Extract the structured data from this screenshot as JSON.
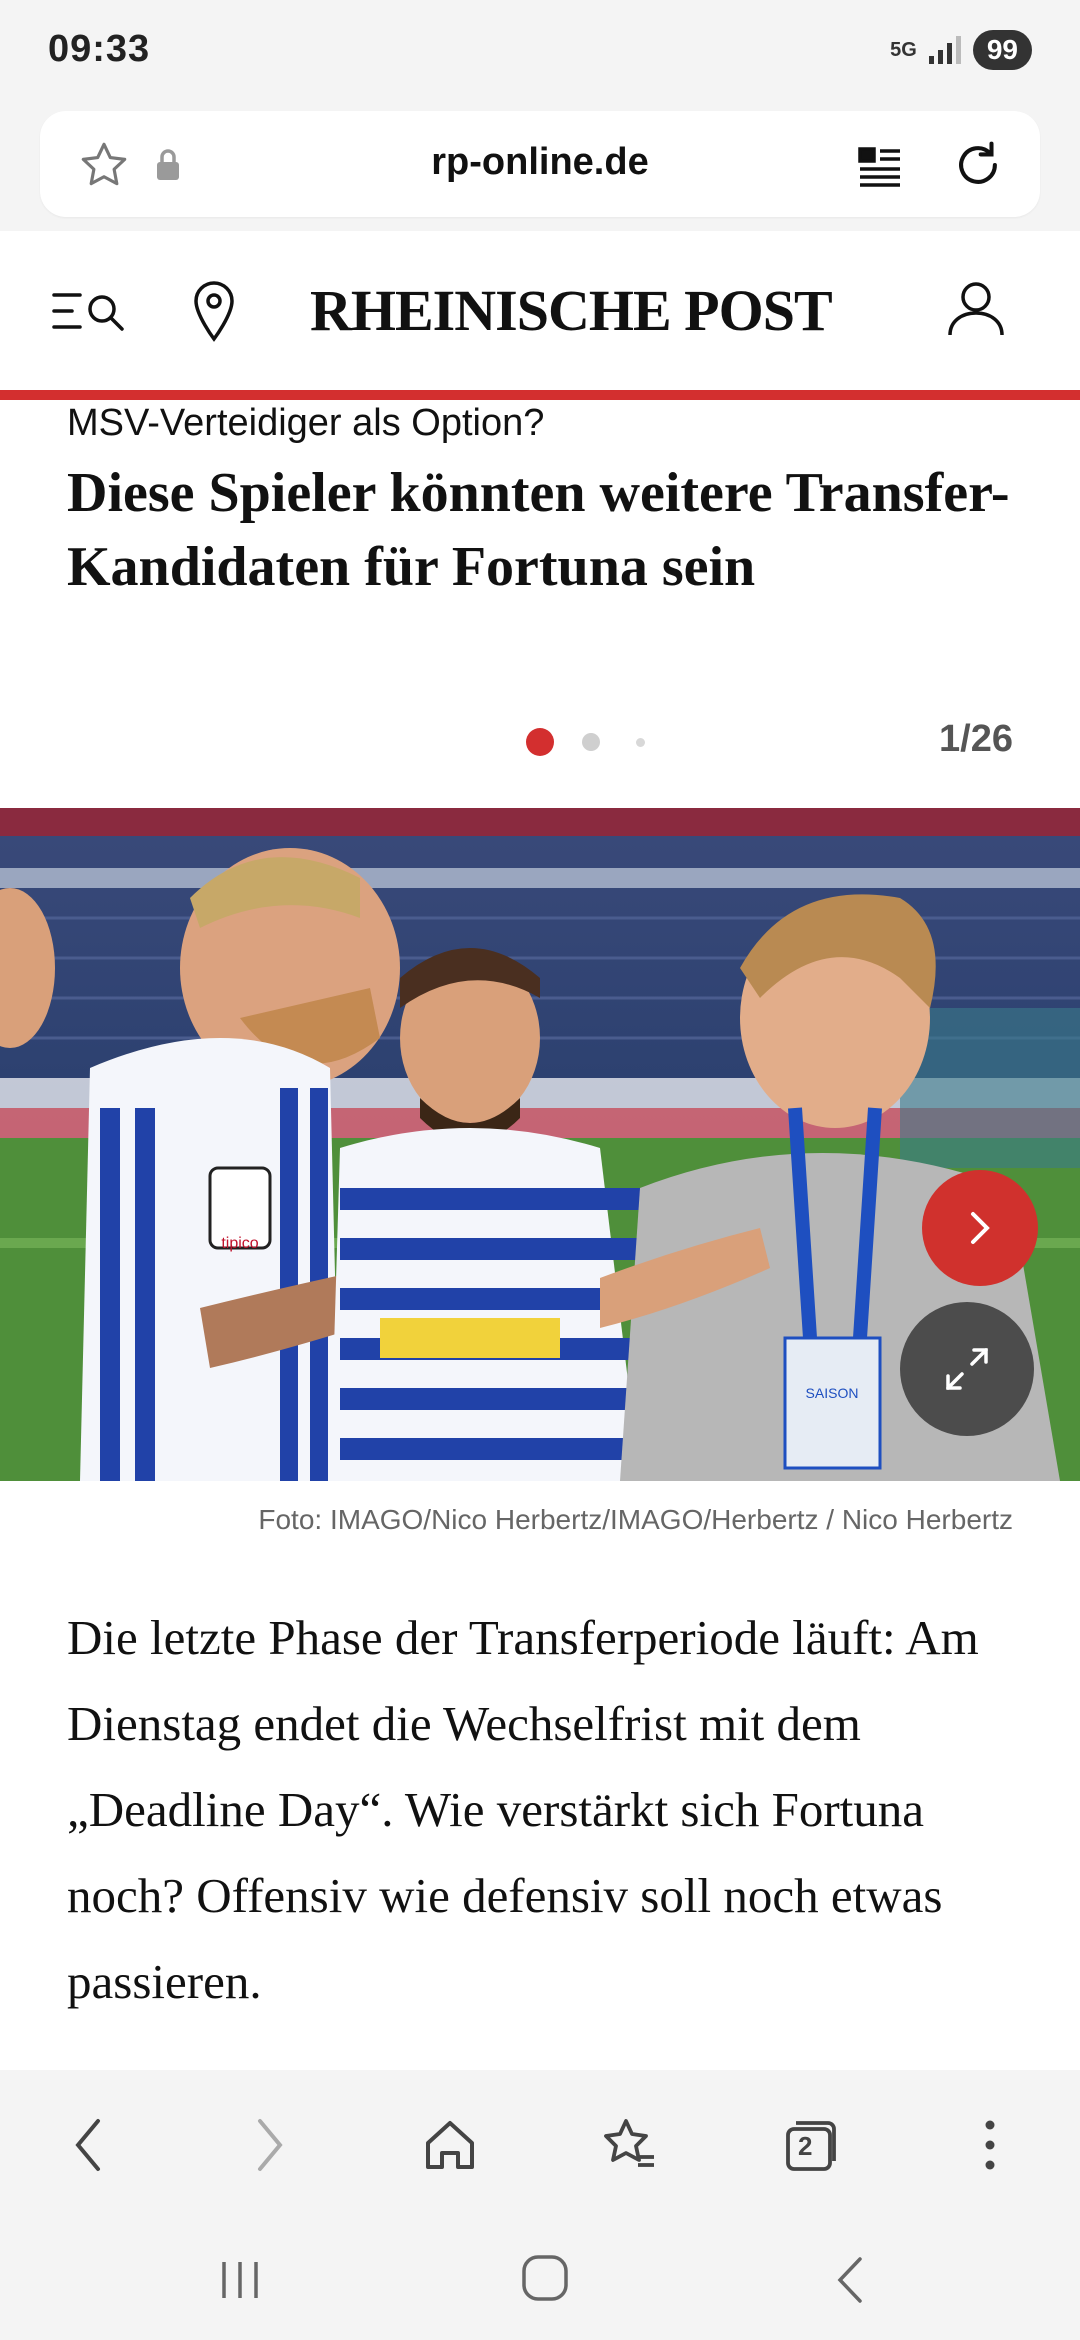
{
  "status": {
    "time": "09:33",
    "network": "5G",
    "battery": "99"
  },
  "browser": {
    "url": "rp-online.de",
    "icons": [
      "star-icon",
      "lock-icon",
      "reader-mode-icon",
      "reload-icon"
    ]
  },
  "site": {
    "logo": "RHEINISCHE POST",
    "icons": [
      "menu-search-icon",
      "location-pin-icon",
      "user-icon"
    ],
    "accent": "#d32f2f"
  },
  "article": {
    "kicker": "MSV-Verteidiger als Option?",
    "headline": "Diese Spieler könnten weitere Transfer-Kandidaten für Fortuna sein",
    "pager": "1/26",
    "caption": "Foto: IMAGO/Nico Herbertz/IMAGO/Herbertz / Nico Herbertz",
    "body": "Die letzte Phase der Transferperiode läuft: Am Dienstag endet die Wechselfrist mit dem „Deadline Day“. Wie verstärkt sich Fortuna noch? Offensiv wie defensiv soll noch etwas passieren.",
    "photo_texts": {
      "sponsor": "tipico",
      "badge": "SAISON"
    }
  },
  "toolbar": {
    "tabs_count": "2"
  }
}
